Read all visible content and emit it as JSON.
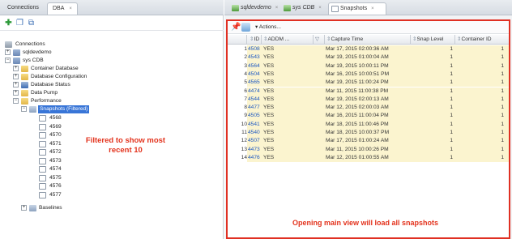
{
  "left_panel": {
    "tabs": [
      {
        "label": "Connections"
      },
      {
        "label": "DBA",
        "close": "×"
      }
    ],
    "tree": [
      {
        "label": "Connections"
      },
      {
        "label": "sqldevdemo"
      },
      {
        "label": "sys CDB"
      },
      {
        "label": "Container Database"
      },
      {
        "label": "Database Configuration"
      },
      {
        "label": "Database Status"
      },
      {
        "label": "Data Pump"
      },
      {
        "label": "Performance"
      },
      {
        "label": "Snapshots (Filtered)"
      },
      {
        "label": "4568"
      },
      {
        "label": "4569"
      },
      {
        "label": "4570"
      },
      {
        "label": "4571"
      },
      {
        "label": "4572"
      },
      {
        "label": "4573"
      },
      {
        "label": "4574"
      },
      {
        "label": "4575"
      },
      {
        "label": "4576"
      },
      {
        "label": "4577"
      },
      {
        "label": "Baselines"
      }
    ],
    "annotation": "Filtered to show most recent 10"
  },
  "right_panel": {
    "tabs": [
      {
        "label": "sqldevdemo",
        "close": "×"
      },
      {
        "label": "sys CDB",
        "close": "×"
      },
      {
        "label": "Snapshots",
        "close": "×"
      }
    ],
    "toolbar": {
      "actions_label": "▾ Actions..."
    },
    "columns": [
      {
        "label": "ID"
      },
      {
        "label": "ADDM ..."
      },
      {
        "label": "Capture Time"
      },
      {
        "label": "Snap Level"
      },
      {
        "label": "Container ID"
      }
    ],
    "rows": [
      {
        "n": "1",
        "id": "4508",
        "addm": "YES",
        "time": "Mar 17, 2015 02:00:36 AM",
        "level": "1",
        "container": "1"
      },
      {
        "n": "2",
        "id": "4543",
        "addm": "YES",
        "time": "Mar 19, 2015 01:00:04 AM",
        "level": "1",
        "container": "1"
      },
      {
        "n": "3",
        "id": "4564",
        "addm": "YES",
        "time": "Mar 19, 2015 10:00:11 PM",
        "level": "1",
        "container": "1"
      },
      {
        "n": "4",
        "id": "4504",
        "addm": "YES",
        "time": "Mar 16, 2015 10:00:51 PM",
        "level": "1",
        "container": "1"
      },
      {
        "n": "5",
        "id": "4565",
        "addm": "YES",
        "time": "Mar 19, 2015 11:00:24 PM",
        "level": "1",
        "container": "1"
      },
      {
        "n": "6",
        "id": "4474",
        "addm": "YES",
        "time": "Mar 11, 2015 11:00:38 PM",
        "level": "1",
        "container": "1"
      },
      {
        "n": "7",
        "id": "4544",
        "addm": "YES",
        "time": "Mar 19, 2015 02:00:13 AM",
        "level": "1",
        "container": "1"
      },
      {
        "n": "8",
        "id": "4477",
        "addm": "YES",
        "time": "Mar 12, 2015 02:00:03 AM",
        "level": "1",
        "container": "1"
      },
      {
        "n": "9",
        "id": "4505",
        "addm": "YES",
        "time": "Mar 16, 2015 11:00:04 PM",
        "level": "1",
        "container": "1"
      },
      {
        "n": "10",
        "id": "4541",
        "addm": "YES",
        "time": "Mar 18, 2015 11:00:46 PM",
        "level": "1",
        "container": "1"
      },
      {
        "n": "11",
        "id": "4540",
        "addm": "YES",
        "time": "Mar 18, 2015 10:00:37 PM",
        "level": "1",
        "container": "1"
      },
      {
        "n": "12",
        "id": "4507",
        "addm": "YES",
        "time": "Mar 17, 2015 01:00:24 AM",
        "level": "1",
        "container": "1"
      },
      {
        "n": "13",
        "id": "4473",
        "addm": "YES",
        "time": "Mar 11, 2015 10:00:26 PM",
        "level": "1",
        "container": "1"
      },
      {
        "n": "14",
        "id": "4476",
        "addm": "YES",
        "time": "Mar 12, 2015 01:00:55 AM",
        "level": "1",
        "container": "1"
      }
    ],
    "annotation": "Opening main view will load all snapshots"
  },
  "colors": {
    "highlight_red": "#e03023",
    "selection_blue": "#3875d7",
    "row_highlight": "#fbf4cf",
    "id_link": "#1a56c2"
  }
}
